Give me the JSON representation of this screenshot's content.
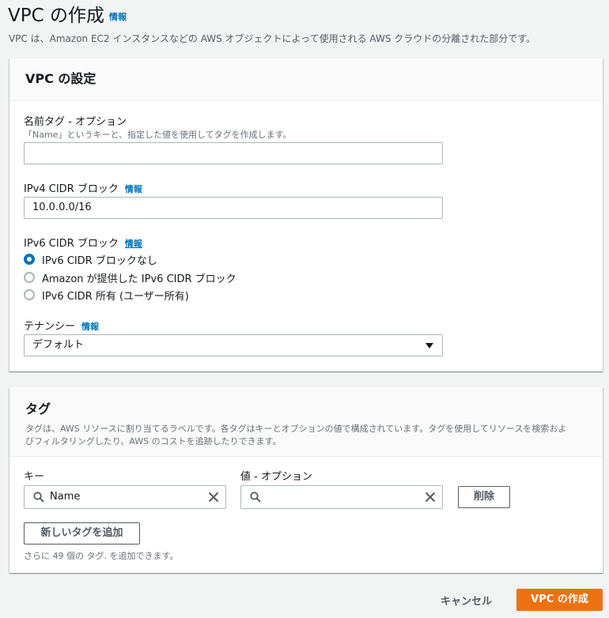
{
  "page": {
    "title": "VPC の作成",
    "info": "情報",
    "description": "VPC は、Amazon EC2 インスタンスなどの AWS オブジェクトによって使用される AWS クラウドの分離された部分です。"
  },
  "vpc_settings": {
    "title": "VPC の設定",
    "name_tag": {
      "label": "名前タグ - オプション",
      "hint": "「Name」というキーと、指定した値を使用してタグを作成します。",
      "value": ""
    },
    "ipv4": {
      "label": "IPv4 CIDR ブロック",
      "info": "情報",
      "value": "10.0.0.0/16"
    },
    "ipv6": {
      "label": "IPv6 CIDR ブロック",
      "info": "情報",
      "options": [
        {
          "label": "IPv6 CIDR ブロックなし",
          "checked": true
        },
        {
          "label": "Amazon が提供した IPv6 CIDR ブロック",
          "checked": false
        },
        {
          "label": "IPv6 CIDR 所有 (ユーザー所有)",
          "checked": false
        }
      ]
    },
    "tenancy": {
      "label": "テナンシー",
      "info": "情報",
      "value": "デフォルト"
    }
  },
  "tags": {
    "title": "タグ",
    "description_line1": "タグは、AWS リソースに割り当てるラベルです。各タグはキーとオプションの値で構成されています。タグを使用してリソースを検索およ",
    "description_line2": "びフィルタリングしたり、AWS のコストを追跡したりできます。",
    "key_label": "キー",
    "value_label": "値 - オプション",
    "key_value": "Name",
    "value_value": "",
    "remove_label": "削除",
    "add_label": "新しいタグを追加",
    "remaining": "さらに 49 個の タグ. を追加できます。"
  },
  "footer": {
    "cancel_label": "キャンセル",
    "create_label": "VPC の作成"
  },
  "colors": {
    "primary": "#ec7211",
    "link": "#0073bb",
    "radio_checked": "#0073bb"
  }
}
